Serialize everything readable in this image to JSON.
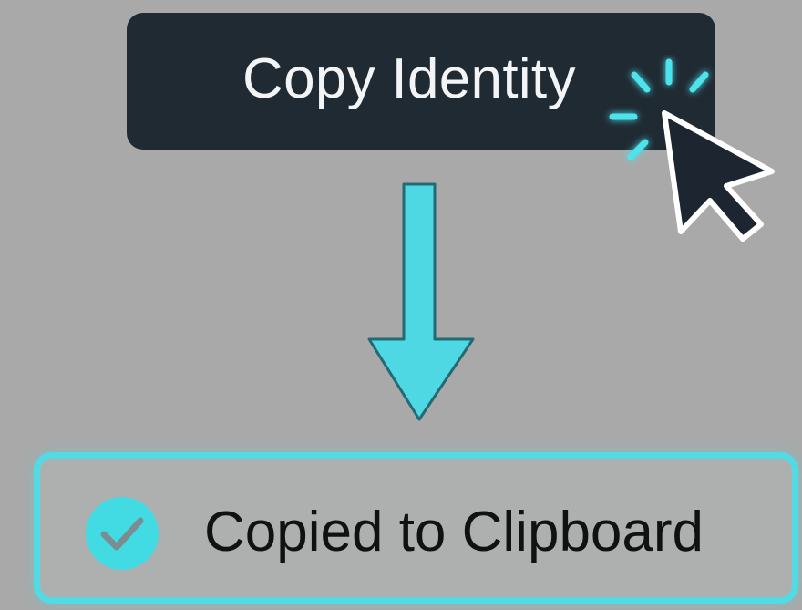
{
  "copy_button": {
    "label": "Copy Identity"
  },
  "toast": {
    "message": "Copied to Clipboard",
    "status": "success"
  },
  "icons": {
    "cursor": "mouse-pointer-icon",
    "click": "click-burst-icon",
    "flow": "arrow-down-icon",
    "check": "checkmark-circle-icon"
  },
  "colors": {
    "page_background": "#a9a9a9",
    "button_background": "#1f2a33",
    "button_text": "#f2f4f5",
    "accent": "#52dbe4",
    "toast_text": "#111111"
  }
}
